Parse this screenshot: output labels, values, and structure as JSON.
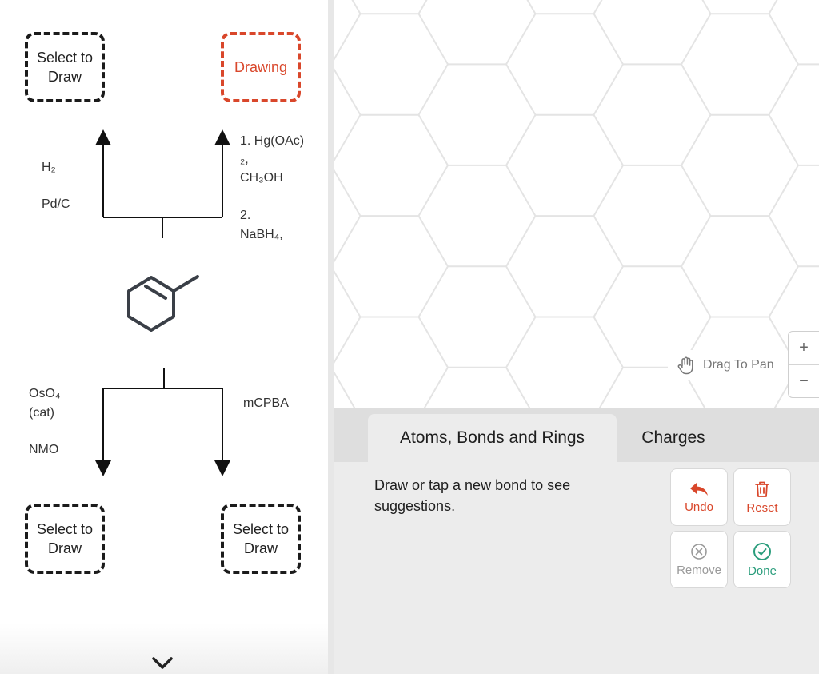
{
  "left_panel": {
    "slots": [
      {
        "label": "Select to Draw"
      },
      {
        "label": "Drawing"
      },
      {
        "label": "Select to Draw"
      },
      {
        "label": "Select to Draw"
      }
    ],
    "reagents": {
      "top_left": {
        "line1": "H₂",
        "line2": "Pd/C"
      },
      "top_right": {
        "line1": "1. Hg(OAc)₂,",
        "line2": "CH₃OH",
        "line3": "2.",
        "line4": "NaBH₄,"
      },
      "bottom_left": {
        "line1": "OsO₄",
        "line2": "(cat)",
        "line3": "NMO"
      },
      "bottom_right": {
        "line1": "mCPBA"
      }
    },
    "expand_icon": "chevron-down-icon"
  },
  "canvas": {
    "pan_hint": "Drag To Pan",
    "pan_icon": "hand-icon",
    "zoom_in_label": "+",
    "zoom_out_label": "−"
  },
  "tools": {
    "tabs": [
      {
        "label": "Atoms, Bonds and Rings",
        "active": true
      },
      {
        "label": "Charges",
        "active": false
      }
    ],
    "hint": "Draw or tap a new bond to see suggestions.",
    "buttons": {
      "undo": "Undo",
      "reset": "Reset",
      "remove": "Remove",
      "done": "Done"
    }
  },
  "colors": {
    "accent_red": "#d9472b",
    "done_green": "#2a9d7c",
    "disabled_grey": "#9a9a9a",
    "grid_line": "#e4e4e4"
  }
}
